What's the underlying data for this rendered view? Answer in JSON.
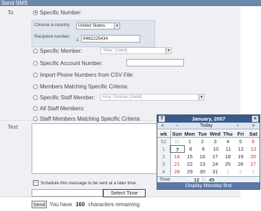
{
  "header": {
    "title": "Send SMS"
  },
  "labels": {
    "to": "To",
    "text": "Text"
  },
  "country": {
    "label": "Choose a country:",
    "selected": "United States",
    "recipient_label": "Recipient number:",
    "prefix": "1",
    "recipient_value": "6462225434"
  },
  "options": [
    {
      "label": "Specific Number:",
      "selected": true
    },
    {
      "label": "Specific Member:",
      "selected": false,
      "select_value": "\"Mita\" [Valid]"
    },
    {
      "label": "Specific Account Number:",
      "selected": false
    },
    {
      "label": "Import Phone Numbers from CSV File:",
      "selected": false
    },
    {
      "label": "Members Matching Specific Criteria:",
      "selected": false
    },
    {
      "label": "Specific Staff Member:",
      "selected": false,
      "select_value": "Amy Thomas [Valid]"
    },
    {
      "label": "All Staff Members:",
      "selected": false
    },
    {
      "label": "Staff Members Matching Specific Criteria:",
      "selected": false
    }
  ],
  "schedule": {
    "checked": true,
    "label": "Schedule this message to be sent at a later time."
  },
  "select_time_button": "Select Time",
  "footer": {
    "send_label": "Send",
    "prefix": "You have",
    "count": "160",
    "suffix": "characters remaining"
  },
  "calendar": {
    "help": "?",
    "title": "January, 2007",
    "close": "×",
    "nav": {
      "prev_year": "«",
      "prev_month": "‹",
      "today": "Today",
      "next_month": "›",
      "next_year": "»"
    },
    "headers": [
      "wk",
      "Sun",
      "Mon",
      "Tue",
      "Wed",
      "Thu",
      "Fri",
      "Sat"
    ],
    "weeks": [
      [
        "52",
        "31",
        "1",
        "2",
        "3",
        "4",
        "5",
        "6"
      ],
      [
        "1",
        "7",
        "8",
        "9",
        "10",
        "11",
        "12",
        "13"
      ],
      [
        "2",
        "14",
        "15",
        "16",
        "17",
        "18",
        "19",
        "20"
      ],
      [
        "3",
        "21",
        "22",
        "23",
        "24",
        "25",
        "26",
        "27"
      ],
      [
        "4",
        "28",
        "29",
        "30",
        "31",
        "1",
        "2",
        "3"
      ]
    ],
    "time_label": "Time:",
    "hour": "12",
    "minute": "45",
    "footer": "Display Monday first",
    "colors": {
      "header": "#3b5a8c",
      "footer": "#5a78a4",
      "weekend": "#c0392b"
    }
  }
}
